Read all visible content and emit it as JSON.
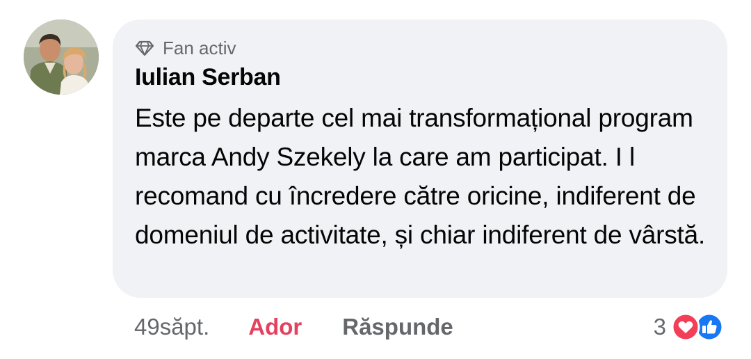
{
  "comment": {
    "badge_label": "Fan activ",
    "author": "Iulian Serban",
    "text": "Este pe departe cel mai transformațional program marca Andy Szekely la care am participat. I l recomand cu încredere către oricine, indiferent de domeniul de activitate, și chiar indiferent de vârstă."
  },
  "actions": {
    "time": "49săpt.",
    "like_label": "Ador",
    "reply_label": "Răspunde",
    "reaction_count": "3"
  },
  "icons": {
    "badge": "diamond-icon",
    "reaction_1": "love-icon",
    "reaction_2": "like-icon"
  },
  "colors": {
    "bubble": "#f0f2f5",
    "like_active": "#e4405f",
    "secondary_text": "#65676b",
    "love_reaction": "#f33e58",
    "like_reaction": "#1877f2"
  }
}
